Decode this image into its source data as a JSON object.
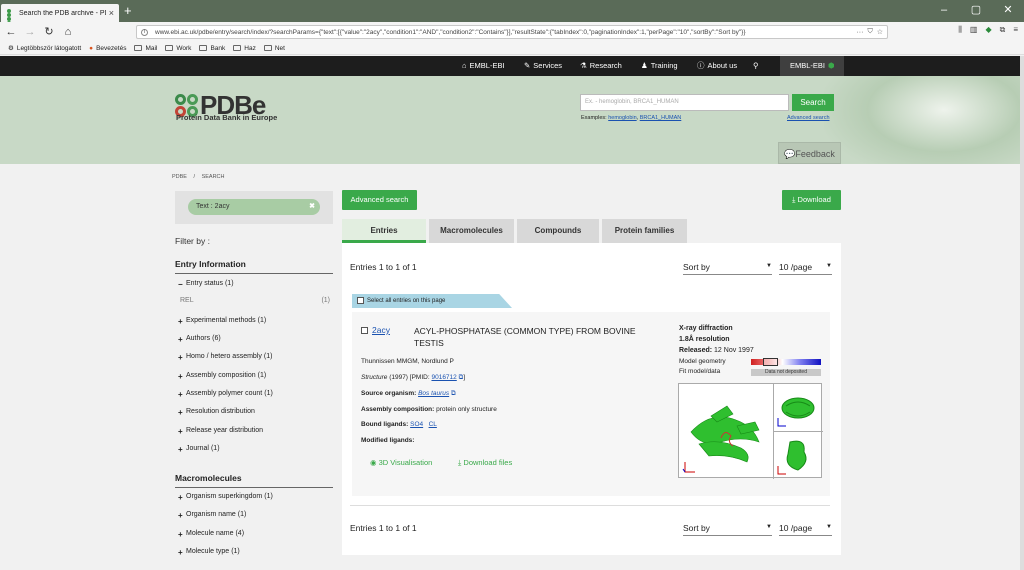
{
  "browser": {
    "tab_title": "Search the PDB archive - PDBe",
    "new_tab": "+",
    "url": "www.ebi.ac.uk/pdbe/entry/search/index/?searchParams={\"text\":[{\"value\":\"2acy\",\"condition1\":\"AND\",\"condition2\":\"Contains\"}],\"resultState\":{\"tabIndex\":0,\"paginationIndex\":1,\"perPage\":\"10\",\"sortBy\":\"Sort by\"}}",
    "url_more": "···",
    "bookmarks": [
      "Legtöbbször látogatott",
      "Bevezetés",
      "Mail",
      "Work",
      "Bank",
      "Haz",
      "Net"
    ]
  },
  "ebi_bar": {
    "items": [
      "EMBL-EBI",
      "Services",
      "Research",
      "Training",
      "About us"
    ],
    "brand": "EMBL-EBI"
  },
  "header": {
    "logo": "PDBe",
    "subtitle": "Protein Data Bank in Europe",
    "search_placeholder": "Ex. - hemoglobin, BRCA1_HUMAN",
    "search_button": "Search",
    "examples_label": "Examples:",
    "examples": [
      "hemoglobin",
      "BRCA1_HUMAN"
    ],
    "advanced_search": "Advanced search",
    "feedback": "Feedback"
  },
  "breadcrumb": {
    "root": "PDBE",
    "sep": "/",
    "current": "SEARCH"
  },
  "sidebar": {
    "chip": "Text : 2acy",
    "chip_close": "✖",
    "filter_by": "Filter by :",
    "entry_info": "Entry Information",
    "entry_status": "Entry status",
    "entry_status_count": "(1)",
    "rel": "REL",
    "rel_count": "(1)",
    "entry_filters": [
      {
        "label": "Experimental methods",
        "count": "(1)"
      },
      {
        "label": "Authors",
        "count": "(6)"
      },
      {
        "label": "Homo / hetero assembly",
        "count": "(1)"
      },
      {
        "label": "Assembly composition",
        "count": "(1)"
      },
      {
        "label": "Assembly polymer count",
        "count": "(1)"
      },
      {
        "label": "Resolution distribution",
        "count": ""
      },
      {
        "label": "Release year distribution",
        "count": ""
      },
      {
        "label": "Journal",
        "count": "(1)"
      }
    ],
    "macromolecules": "Macromolecules",
    "macro_filters": [
      {
        "label": "Organism superkingdom",
        "count": "(1)"
      },
      {
        "label": "Organism name",
        "count": "(1)"
      },
      {
        "label": "Molecule name",
        "count": "(4)"
      },
      {
        "label": "Molecule type",
        "count": "(1)"
      }
    ]
  },
  "main": {
    "advanced_search": "Advanced search",
    "download": "Download",
    "tabs": [
      "Entries",
      "Macromolecules",
      "Compounds",
      "Protein families"
    ],
    "entries_count": "Entries 1 to 1 of 1",
    "sort_by": "Sort by",
    "per_page": "10 /page",
    "select_all": "Select all entries on this page"
  },
  "entry": {
    "id": "2acy",
    "title": "ACYL-PHOSPHATASE (COMMON TYPE) FROM BOVINE TESTIS",
    "authors": "Thunnissen MMGM, Nordlund P",
    "journal": "Structure",
    "citation": "(1997) [PMID:",
    "pmid": "9016712",
    "citation_end": "]",
    "source_label": "Source organism:",
    "source": "Bos taurus",
    "assembly_label": "Assembly composition:",
    "assembly": "protein only structure",
    "ligands_label": "Bound ligands:",
    "ligands": [
      "SO4",
      "CL"
    ],
    "modified_label": "Modified ligands:",
    "vis": "3D Visualisation",
    "dl": "Download files",
    "method": "X-ray diffraction",
    "resolution": "1.8Å resolution",
    "released_label": "Released:",
    "released": "12 Nov 1997",
    "model_geometry": "Model geometry",
    "fit": "Fit model/data",
    "not_deposited": "Data not deposited"
  }
}
